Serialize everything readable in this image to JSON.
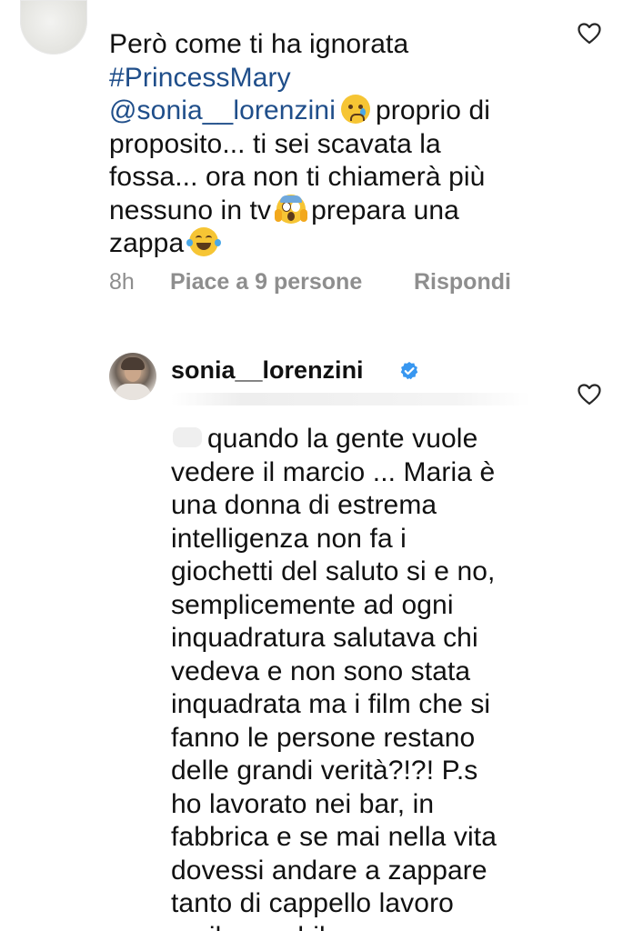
{
  "comment1": {
    "line1": "Però come ti ha ignorata",
    "hashtag": "#PrincessMary",
    "mention": "@sonia__lorenzini",
    "line3_rest": "proprio di",
    "line4": "proposito... ti sei scavata la",
    "line5": "fossa... ora non ti chiamerà più",
    "line6_a": "nessuno in tv",
    "line6_b": "prepara una",
    "line7": "zappa",
    "emoji_1": "crying-face-emoji",
    "emoji_2": "screaming-face-emoji",
    "emoji_3": "tears-of-joy-emoji",
    "time": "8h",
    "likes": "Piace a 9 persone",
    "reply": "Rispondi"
  },
  "reply": {
    "username": "sonia__lorenzini",
    "verified_icon": "verified-badge-icon",
    "lines": [
      "quando la gente vuole",
      "vedere il marcio ... Maria è",
      "una donna di estrema",
      "intelligenza non fa i",
      "giochetti del saluto si e no,",
      "semplicemente ad ogni",
      "inquadratura salutava chi",
      "vedeva e non sono stata",
      "inquadrata ma i film che si",
      "fanno le persone restano",
      "delle grandi verità?!?! P.s",
      "ho lavorato nei bar, in",
      "fabbrica e se mai nella vita",
      "dovessi andare a zappare",
      "tanto di cappello lavoro",
      "umile e nobile"
    ]
  },
  "colors": {
    "link": "#1f4e8a",
    "meta": "#8e8e8e",
    "verified": "#3897f0"
  },
  "icons": {
    "like": "heart-outline-icon"
  }
}
